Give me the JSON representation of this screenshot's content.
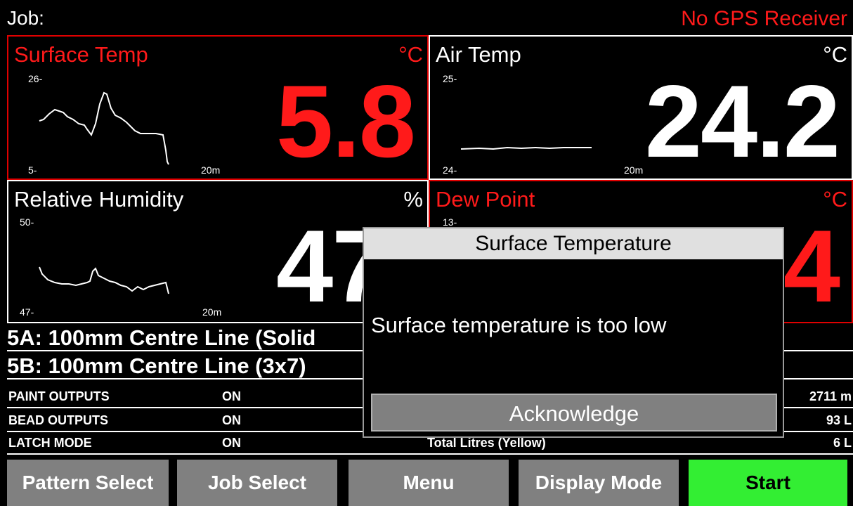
{
  "header": {
    "job_label": "Job:",
    "gps_status": "No GPS Receiver"
  },
  "panels": {
    "surface_temp": {
      "title": "Surface Temp",
      "unit": "°C",
      "value": "5.8",
      "y_max": "26-",
      "y_min": "5-",
      "x_span": "20m",
      "alarm": true
    },
    "air_temp": {
      "title": "Air Temp",
      "unit": "°C",
      "value": "24.2",
      "y_max": "25-",
      "y_min": "24-",
      "x_span": "20m",
      "alarm": false
    },
    "humidity": {
      "title": "Relative Humidity",
      "unit": "%",
      "value": "47.",
      "y_max": "50-",
      "y_min": "47-",
      "x_span": "20m",
      "alarm": false
    },
    "dew_point": {
      "title": "Dew Point",
      "unit": "°C",
      "value": "4",
      "y_max": "13-",
      "alarm": true
    }
  },
  "patterns": [
    {
      "label": "5A: 100mm Centre Line (Solid"
    },
    {
      "label": "5B: 100mm Centre Line (3x7)"
    }
  ],
  "info_rows": [
    {
      "key": "PAINT OUTPUTS",
      "value": "ON",
      "right_key": "",
      "right_value": "2711 m"
    },
    {
      "key": "BEAD OUTPUTS",
      "value": "ON",
      "right_key": "",
      "right_value": "93 L"
    },
    {
      "key": "LATCH MODE",
      "value": "ON",
      "right_key": "Total Litres (Yellow)",
      "right_value": "6 L"
    }
  ],
  "dialog": {
    "title": "Surface Temperature",
    "message": "Surface temperature is too low",
    "button": "Acknowledge"
  },
  "buttons": {
    "pattern_select": "Pattern Select",
    "job_select": "Job Select",
    "menu": "Menu",
    "display_mode": "Display Mode",
    "start": "Start"
  },
  "colors": {
    "alarm": "#ff1a1a",
    "start": "#33ee33",
    "button": "#808080"
  }
}
